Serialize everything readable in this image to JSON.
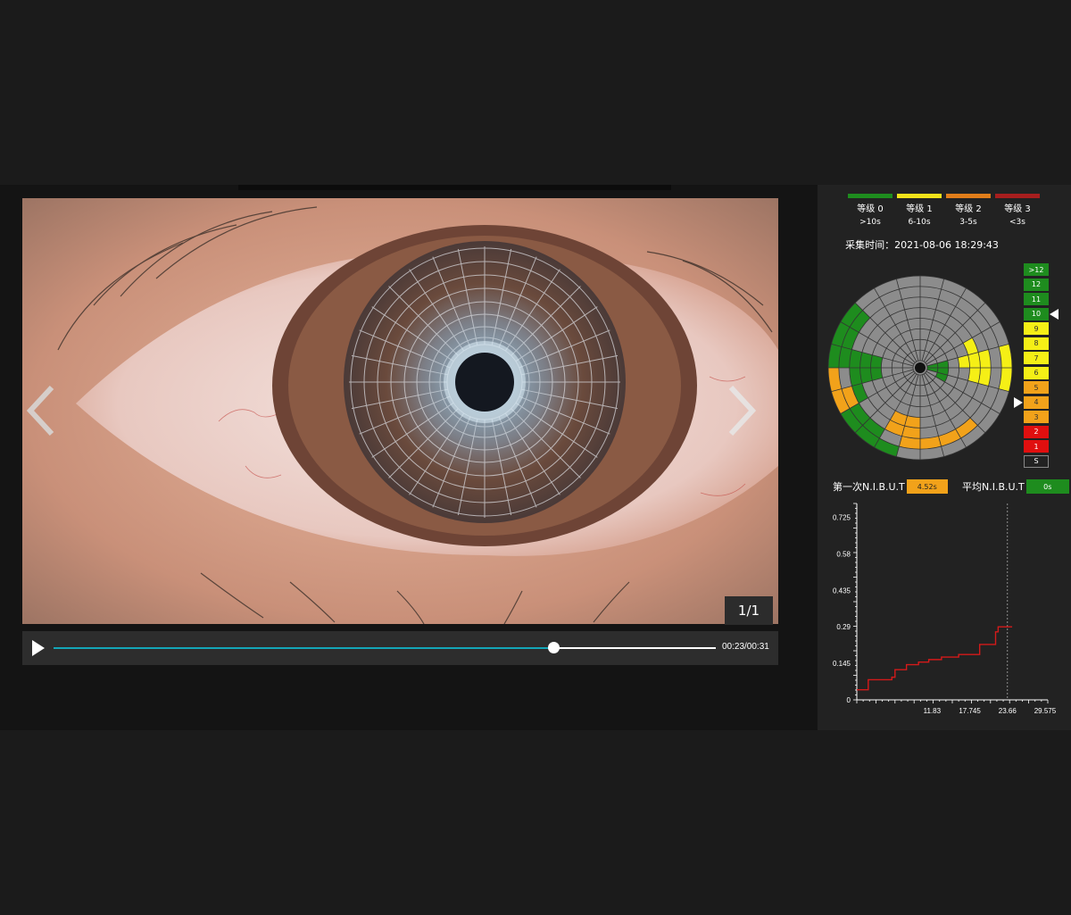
{
  "viewer": {
    "counter": "1/1",
    "prev_icon": "chevron-left-icon",
    "next_icon": "chevron-right-icon"
  },
  "player": {
    "play_icon": "play-icon",
    "progress": 0.755,
    "time": "00:23/00:31"
  },
  "legend": [
    {
      "level": "等级 0",
      "range": ">10s",
      "color": "#1e8c1e"
    },
    {
      "level": "等级 1",
      "range": "6-10s",
      "color": "#f2e21a"
    },
    {
      "level": "等级 2",
      "range": "3-5s",
      "color": "#e07d1a"
    },
    {
      "level": "等级 3",
      "range": "<3s",
      "color": "#a71e1e"
    }
  ],
  "capture_time": "采集时间：2021-08-06 18:29:43",
  "scale": [
    {
      "label": ">12",
      "color": "#1e8c1e"
    },
    {
      "label": "12",
      "color": "#1e8c1e"
    },
    {
      "label": "11",
      "color": "#1e8c1e"
    },
    {
      "label": "10",
      "color": "#1e8c1e"
    },
    {
      "label": "9",
      "color": "#f5ef16"
    },
    {
      "label": "8",
      "color": "#f5ef16"
    },
    {
      "label": "7",
      "color": "#f5ef16"
    },
    {
      "label": "6",
      "color": "#f5ef16"
    },
    {
      "label": "5",
      "color": "#f2a21a"
    },
    {
      "label": "4",
      "color": "#f2a21a"
    },
    {
      "label": "3",
      "color": "#f2a21a"
    },
    {
      "label": "2",
      "color": "#e00f0f"
    },
    {
      "label": "1",
      "color": "#e00f0f"
    },
    {
      "label": "S",
      "color": "#222222"
    }
  ],
  "nibut": {
    "first_label": "第一次N.I.B.U.T",
    "first_value": "4.52s",
    "first_color": "#f2a21a",
    "avg_label": "平均N.I.B.U.T",
    "avg_value": "0s",
    "avg_color": "#1e8c1e"
  },
  "chart_data": {
    "type": "line",
    "x_ticks": [
      "11.83",
      "17.745",
      "23.66",
      "29.575"
    ],
    "y_ticks": [
      "0",
      "0.145",
      "0.29",
      "0.435",
      "0.58",
      "0.725"
    ],
    "xlim": [
      0,
      30
    ],
    "ylim": [
      0,
      0.78
    ],
    "vline_x": 23.66,
    "line_color": "#d41a1a",
    "series": [
      {
        "x": [
          0,
          1.8,
          1.8,
          5.5,
          5.5,
          6.0,
          6.0,
          7.8,
          7.8,
          9.7,
          9.7,
          11.3,
          11.3,
          13.3,
          13.3,
          16.0,
          16.0,
          19.3,
          19.3,
          21.8,
          21.8,
          22.2,
          22.2,
          24.4
        ],
        "y": [
          0.04,
          0.04,
          0.08,
          0.08,
          0.09,
          0.09,
          0.12,
          0.12,
          0.14,
          0.14,
          0.15,
          0.15,
          0.16,
          0.16,
          0.17,
          0.17,
          0.18,
          0.18,
          0.22,
          0.22,
          0.27,
          0.27,
          0.29,
          0.29
        ]
      }
    ]
  }
}
